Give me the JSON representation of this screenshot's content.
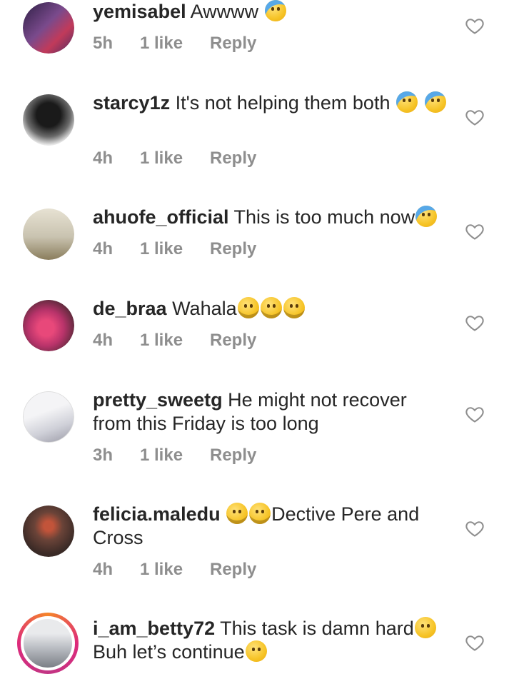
{
  "comments": [
    {
      "username": "yemisabel",
      "text": "Awwww",
      "emoji": "cry",
      "time": "5h",
      "likes": "1 like",
      "reply": "Reply"
    },
    {
      "username": "starcy1z",
      "text": "It's not helping them both",
      "emoji": "cry",
      "time": "4h",
      "likes": "1 like",
      "reply": "Reply"
    },
    {
      "username": "ahuofe_official",
      "text": "This is too much now",
      "emoji": "cry",
      "time": "4h",
      "likes": "1 like",
      "reply": "Reply"
    },
    {
      "username": "de_braa",
      "text": "Wahala",
      "emoji": "laugh",
      "time": "4h",
      "likes": "1 like",
      "reply": "Reply"
    },
    {
      "username": "pretty_sweetg",
      "text": "He might not recover from this Friday is too long",
      "time": "3h",
      "likes": "1 like",
      "reply": "Reply"
    },
    {
      "username": "felicia.maledu",
      "text": "Dective Pere and Cross",
      "emoji": "laugh",
      "time": "4h",
      "likes": "1 like",
      "reply": "Reply"
    },
    {
      "username": "i_am_betty72",
      "text": "This task is damn hard",
      "text2": "Buh let’s continue",
      "emoji": "sleepy",
      "time": "",
      "likes": "",
      "reply": ""
    }
  ],
  "icons": {
    "like": "heart-outline-icon"
  },
  "colors": {
    "text": "#262626",
    "meta": "#8e8e8e"
  }
}
